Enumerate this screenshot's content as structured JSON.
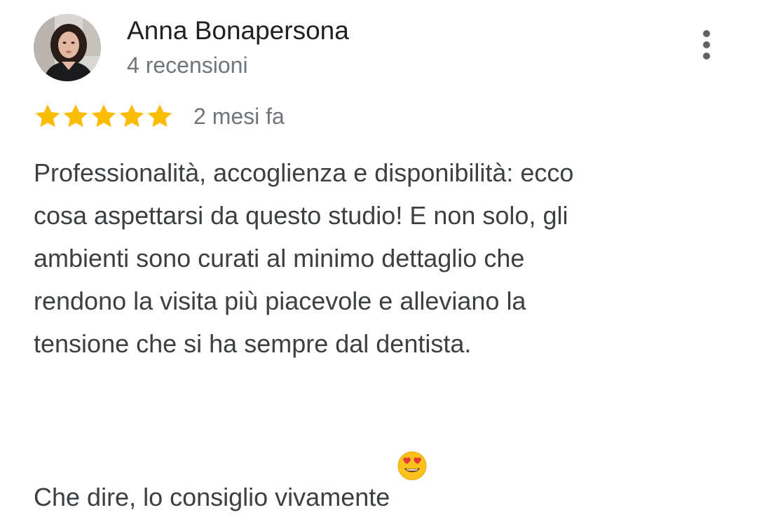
{
  "review": {
    "author_name": "Anna Bonapersona",
    "review_count": "4 recensioni",
    "rating": 5,
    "rating_max": 5,
    "date": "2 mesi fa",
    "text_paragraph_1": "Professionalità, accoglienza e disponibilità: ecco\ncosa aspettarsi da questo studio! E non solo, gli\nambienti sono curati al minimo dettaglio che\nrendono la visita più piacevole e alleviano la\ntensione che si ha sempre dal dentista.",
    "text_paragraph_2": "Che dire, lo consiglio vivamente",
    "trailing_emoji": "smiling-face-with-heart-eyes"
  },
  "icons": {
    "avatar": "user-avatar-photo",
    "more": "more-vert-icon",
    "star": "star-icon"
  },
  "colors": {
    "star": "#fbbc04",
    "name": "#202124",
    "secondary": "#70757a",
    "body": "#3c4043"
  }
}
